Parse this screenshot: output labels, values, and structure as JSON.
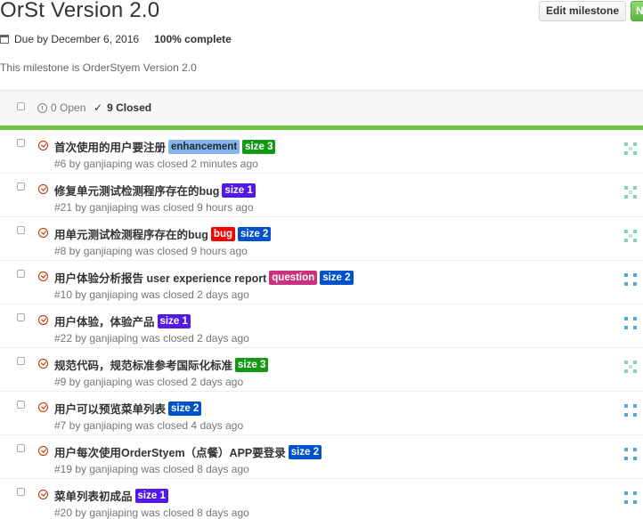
{
  "milestone": {
    "title": "OrSt Version 2.0",
    "due": "Due by December 6, 2016",
    "complete": "100% complete",
    "description": "This milestone is OrderStyem Version 2.0"
  },
  "buttons": {
    "edit": "Edit milestone",
    "new": "N"
  },
  "filters": {
    "open": "0 Open",
    "closed": "9 Closed",
    "closed_check": "✓"
  },
  "colors": {
    "progress": "#6cc644",
    "closed_issue": "#bd2c00"
  },
  "issues": [
    {
      "title": "首次使用的用户要注册",
      "labels": [
        {
          "text": "enhancement",
          "bg": "#84b6eb",
          "fg": "#1c2733"
        },
        {
          "text": "size 3",
          "bg": "#159818",
          "fg": "#ffffff"
        }
      ],
      "meta": "#6 by ganjiaping was closed 2 minutes ago",
      "avatar": "green"
    },
    {
      "title": "修复单元测试检测程序存在的bug",
      "labels": [
        {
          "text": "size 1",
          "bg": "#5319e7",
          "fg": "#ffffff"
        }
      ],
      "meta": "#21 by ganjiaping was closed 9 hours ago",
      "avatar": "green"
    },
    {
      "title": "用单元测试检测程序存在的bug",
      "labels": [
        {
          "text": "bug",
          "bg": "#ee0701",
          "fg": "#ffffff"
        },
        {
          "text": "size 2",
          "bg": "#0052cc",
          "fg": "#ffffff"
        }
      ],
      "meta": "#8 by ganjiaping was closed 9 hours ago",
      "avatar": "green"
    },
    {
      "title": "用户体验分析报告 user experience report",
      "labels": [
        {
          "text": "question",
          "bg": "#cc317c",
          "fg": "#ffffff"
        },
        {
          "text": "size 2",
          "bg": "#0052cc",
          "fg": "#ffffff"
        }
      ],
      "meta": "#10 by ganjiaping was closed 2 days ago",
      "avatar": "blue"
    },
    {
      "title": "用户体验，体验产品",
      "labels": [
        {
          "text": "size 1",
          "bg": "#5319e7",
          "fg": "#ffffff"
        }
      ],
      "meta": "#22 by ganjiaping was closed 2 days ago",
      "avatar": "blue"
    },
    {
      "title": "规范代码，规范标准参考国际化标准",
      "labels": [
        {
          "text": "size 3",
          "bg": "#159818",
          "fg": "#ffffff"
        }
      ],
      "meta": "#9 by ganjiaping was closed 2 days ago",
      "avatar": "green"
    },
    {
      "title": "用户可以预览菜单列表",
      "labels": [
        {
          "text": "size 2",
          "bg": "#0052cc",
          "fg": "#ffffff"
        }
      ],
      "meta": "#7 by ganjiaping was closed 4 days ago",
      "avatar": "blue"
    },
    {
      "title": "用户每次使用OrderStyem（点餐）APP要登录",
      "labels": [
        {
          "text": "size 2",
          "bg": "#0052cc",
          "fg": "#ffffff"
        }
      ],
      "meta": "#19 by ganjiaping was closed 8 days ago",
      "avatar": "blue"
    },
    {
      "title": "菜单列表初成品",
      "labels": [
        {
          "text": "size 1",
          "bg": "#5319e7",
          "fg": "#ffffff"
        }
      ],
      "meta": "#20 by ganjiaping was closed 8 days ago",
      "avatar": "blue"
    }
  ]
}
